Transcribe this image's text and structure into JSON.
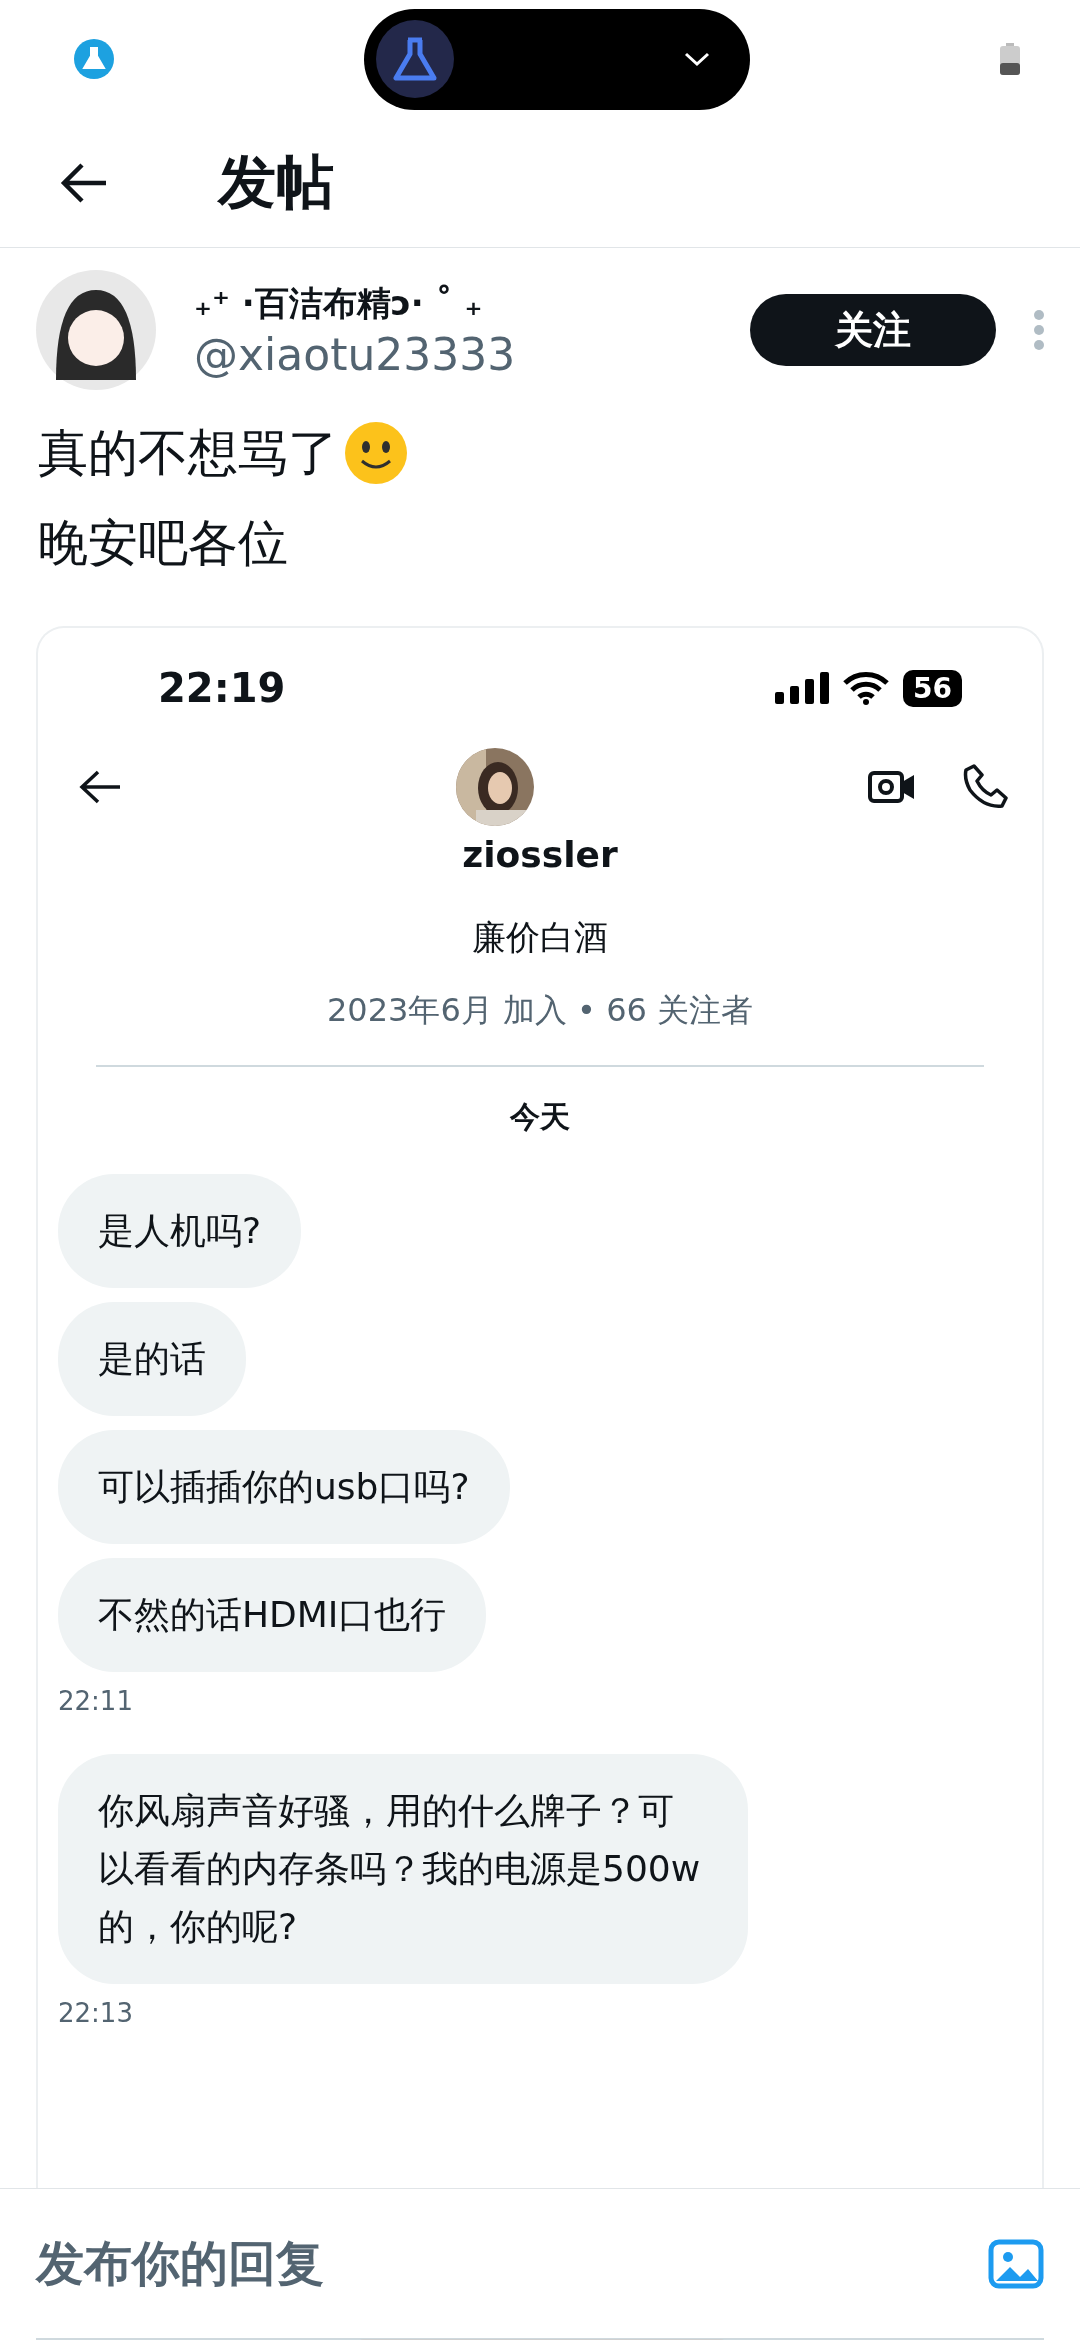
{
  "header": {
    "title": "发帖"
  },
  "post": {
    "author_name": "₊⁺ ·百洁布精ↄ· ˚ ₊",
    "handle": "@xiaotu23333",
    "follow_button": "关注",
    "lines": [
      "真的不想骂了",
      "晚安吧各位"
    ]
  },
  "embedded_screenshot": {
    "status_time": "22:19",
    "battery": "56",
    "contact_name": "ziossler",
    "bio": "廉价白酒",
    "meta": "2023年6月 加入 • 66 关注者",
    "day_label": "今天",
    "message_groups": [
      {
        "messages": [
          "是人机吗?",
          "是的话",
          "可以插插你的usb口吗?",
          "不然的话HDMI口也行"
        ],
        "time": "22:11"
      },
      {
        "messages": [
          "你风扇声音好骚，用的什么牌子？可以看看的内存条吗？我的电源是500w的，你的呢?"
        ],
        "time": "22:13"
      }
    ]
  },
  "reply_bar": {
    "placeholder": "发布你的回复"
  }
}
